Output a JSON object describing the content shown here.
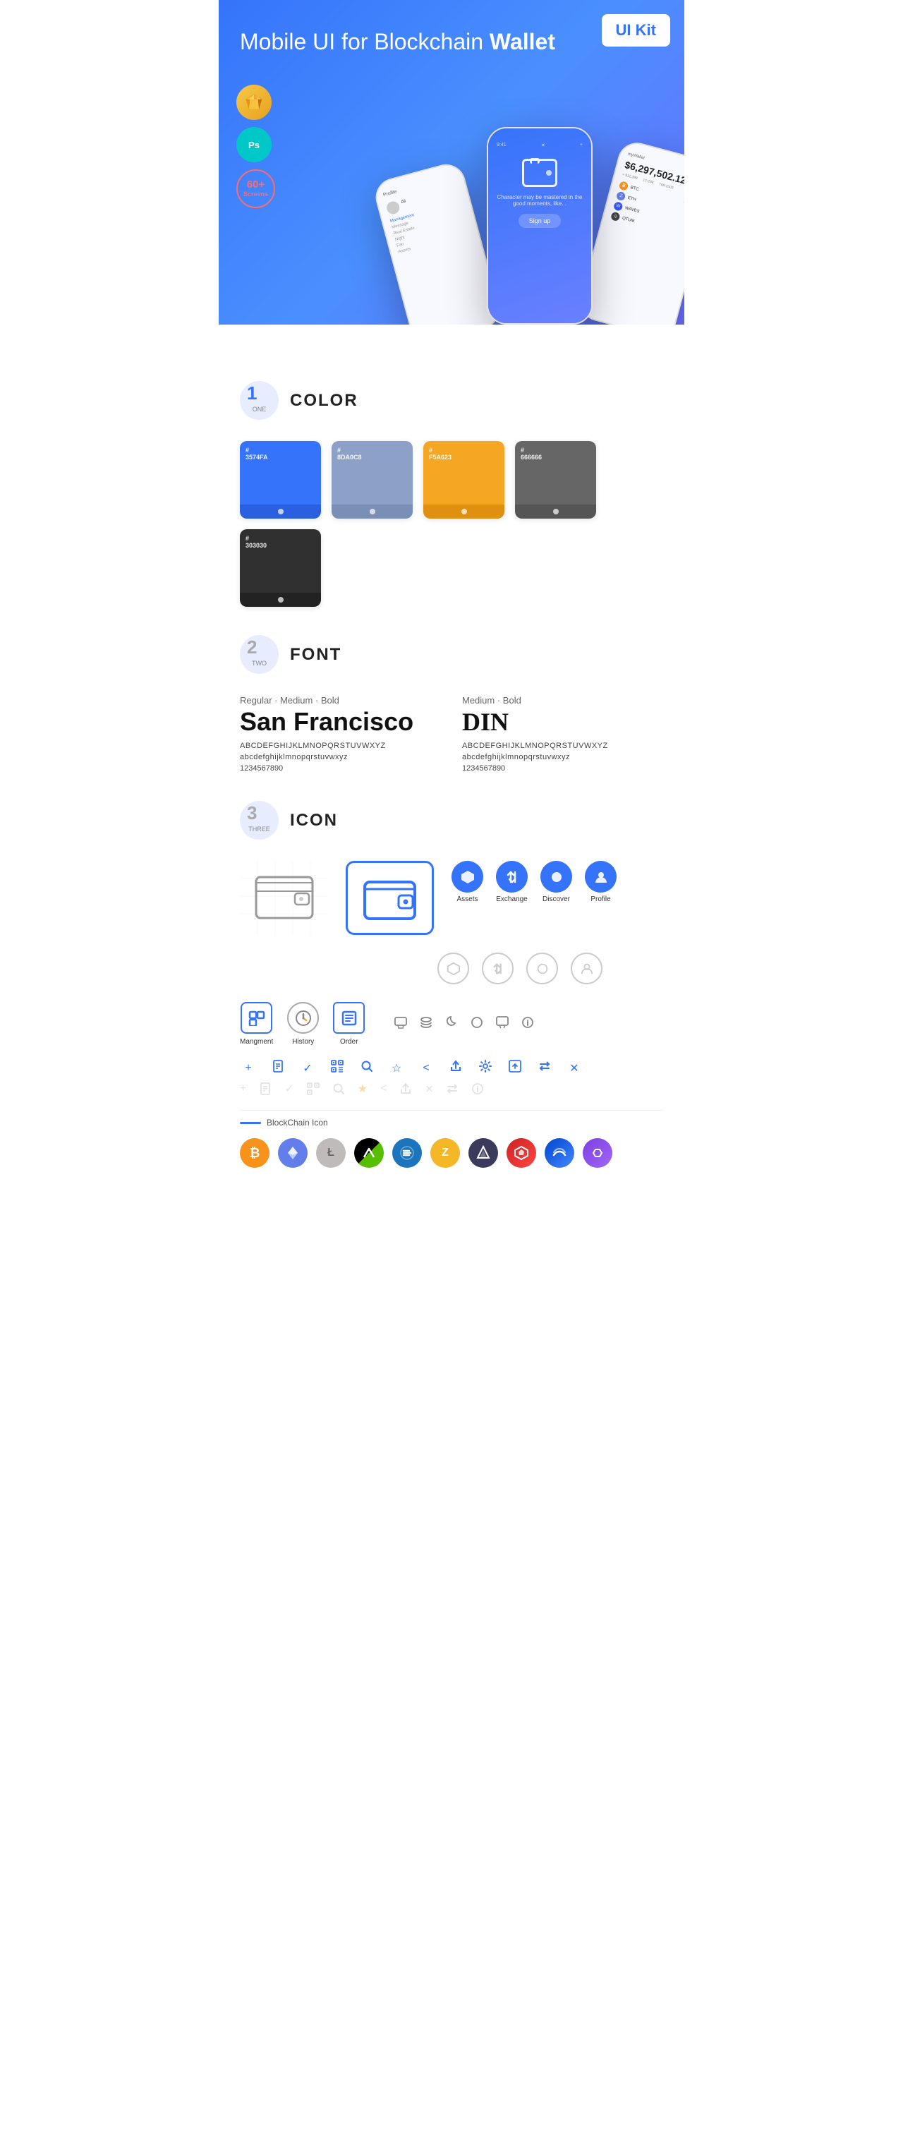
{
  "hero": {
    "title_part1": "Mobile UI for Blockchain ",
    "title_bold": "Wallet",
    "badge": "UI Kit",
    "sketch_label": "S",
    "ps_label": "Ps",
    "screens_count": "60+",
    "screens_label": "Screens"
  },
  "sections": {
    "color": {
      "number": "1",
      "text": "ONE",
      "title": "COLOR",
      "swatches": [
        {
          "hex": "#3574FA",
          "code": "#\n3574FA"
        },
        {
          "hex": "#8DA0C8",
          "code": "#\n8DA0C8"
        },
        {
          "hex": "#F5A623",
          "code": "#\nF5A623"
        },
        {
          "hex": "#666666",
          "code": "#\n666666"
        },
        {
          "hex": "#303030",
          "code": "#\n303030"
        }
      ]
    },
    "font": {
      "number": "2",
      "text": "TWO",
      "title": "FONT",
      "font1": {
        "style": "Regular · Medium · Bold",
        "name": "San Francisco",
        "uppercase": "ABCDEFGHIJKLMNOPQRSTUVWXYZ",
        "lowercase": "abcdefghijklmnopqrstuvwxyz",
        "numbers": "1234567890"
      },
      "font2": {
        "style": "Medium · Bold",
        "name": "DIN",
        "uppercase": "ABCDEFGHIJKLMNOPQRSTUVWXYZ",
        "lowercase": "abcdefghijklmnopqrstuvwxyz",
        "numbers": "1234567890"
      }
    },
    "icon": {
      "number": "3",
      "text": "THREE",
      "title": "ICON",
      "nav_icons": [
        {
          "label": "Assets",
          "symbol": "◆"
        },
        {
          "label": "Exchange",
          "symbol": "⇄"
        },
        {
          "label": "Discover",
          "symbol": "●"
        },
        {
          "label": "Profile",
          "symbol": "👤"
        }
      ],
      "bottom_icons": [
        {
          "label": "Mangment",
          "symbol": "▦"
        },
        {
          "label": "History",
          "symbol": "⏱"
        },
        {
          "label": "Order",
          "symbol": "≡"
        }
      ],
      "blockchain_label": "BlockChain Icon",
      "crypto": [
        {
          "symbol": "₿",
          "bg": "#f7931a",
          "name": "Bitcoin"
        },
        {
          "symbol": "Ξ",
          "bg": "#627eea",
          "name": "Ethereum"
        },
        {
          "symbol": "Ł",
          "bg": "#bfbbbb",
          "name": "Litecoin"
        },
        {
          "symbol": "N",
          "bg": "#58bf00",
          "name": "NEO"
        },
        {
          "symbol": "D",
          "bg": "#1c75bc",
          "name": "Dash"
        },
        {
          "symbol": "Z",
          "bg": "#f4b728",
          "name": "Zcash"
        },
        {
          "symbol": "✦",
          "bg": "#4a4a6a",
          "name": "IOTA"
        },
        {
          "symbol": "△",
          "bg": "#cc4444",
          "name": "Ark"
        },
        {
          "symbol": "W",
          "bg": "#3355ff",
          "name": "Waves"
        },
        {
          "symbol": "⬡",
          "bg": "#8247e5",
          "name": "Polygon"
        }
      ]
    }
  }
}
